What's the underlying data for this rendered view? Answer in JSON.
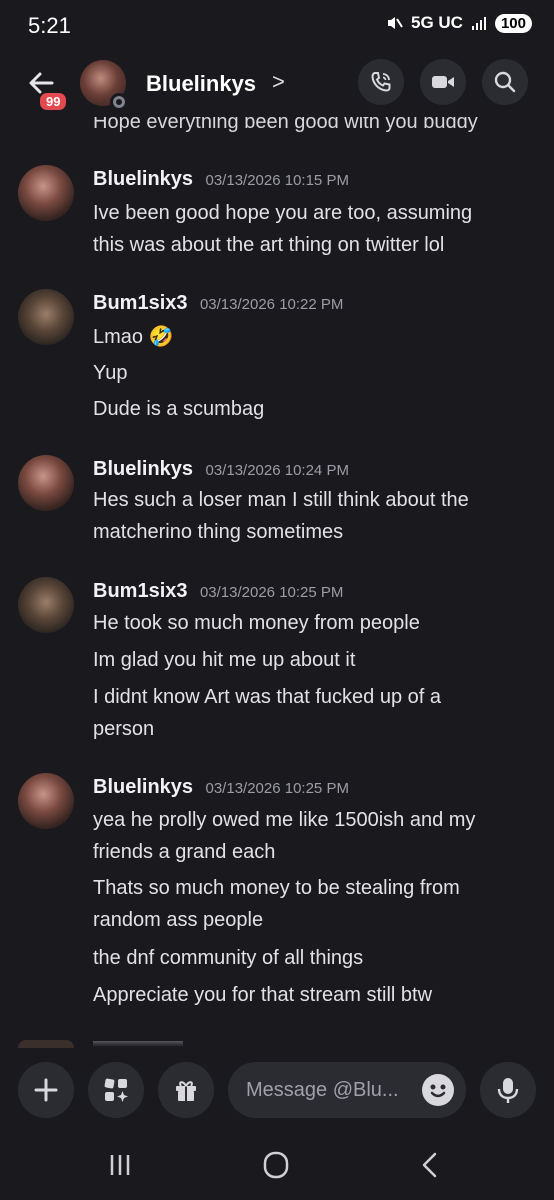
{
  "status_bar": {
    "time": "5:21",
    "network": "5G UC",
    "battery": "100"
  },
  "header": {
    "unread_badge": "99",
    "title": "Bluelinkys",
    "chevron": ">"
  },
  "cutoff_text": "Hope everything been good with you buddy",
  "messages": [
    {
      "author": "Bluelinkys",
      "timestamp": "03/13/2026 10:15 PM",
      "lines": [
        "Ive been good hope you are too, assuming",
        "this was about the art thing on twitter lol"
      ]
    },
    {
      "author": "Bum1six3",
      "timestamp": "03/13/2026 10:22 PM",
      "lines": [
        "Lmao 🤣",
        "Yup",
        "Dude is a scumbag"
      ]
    },
    {
      "author": "Bluelinkys",
      "timestamp": "03/13/2026 10:24 PM",
      "lines": [
        "Hes such a loser man I still think about the",
        "matcherino thing sometimes"
      ]
    },
    {
      "author": "Bum1six3",
      "timestamp": "03/13/2026 10:25 PM",
      "lines": [
        "He took so much money from people",
        "Im glad you hit me up about it",
        "I didnt know Art was that fucked up of a",
        "person"
      ]
    },
    {
      "author": "Bluelinkys",
      "timestamp": "03/13/2026 10:25 PM",
      "lines": [
        "yea he prolly owed me like 1500ish and my",
        "friends a grand each",
        "Thats so much money to be stealing from",
        "random ass people",
        "the dnf community of all things",
        "Appreciate you for that stream still btw"
      ]
    }
  ],
  "composer": {
    "placeholder": "Message @Blu..."
  },
  "icons": {
    "back": "arrow-left-icon",
    "call": "phone-icon",
    "video": "video-camera-icon",
    "search": "search-icon",
    "add": "plus-icon",
    "apps": "apps-icon",
    "gift": "gift-icon",
    "emoji": "emoji-icon",
    "mic": "microphone-icon"
  }
}
